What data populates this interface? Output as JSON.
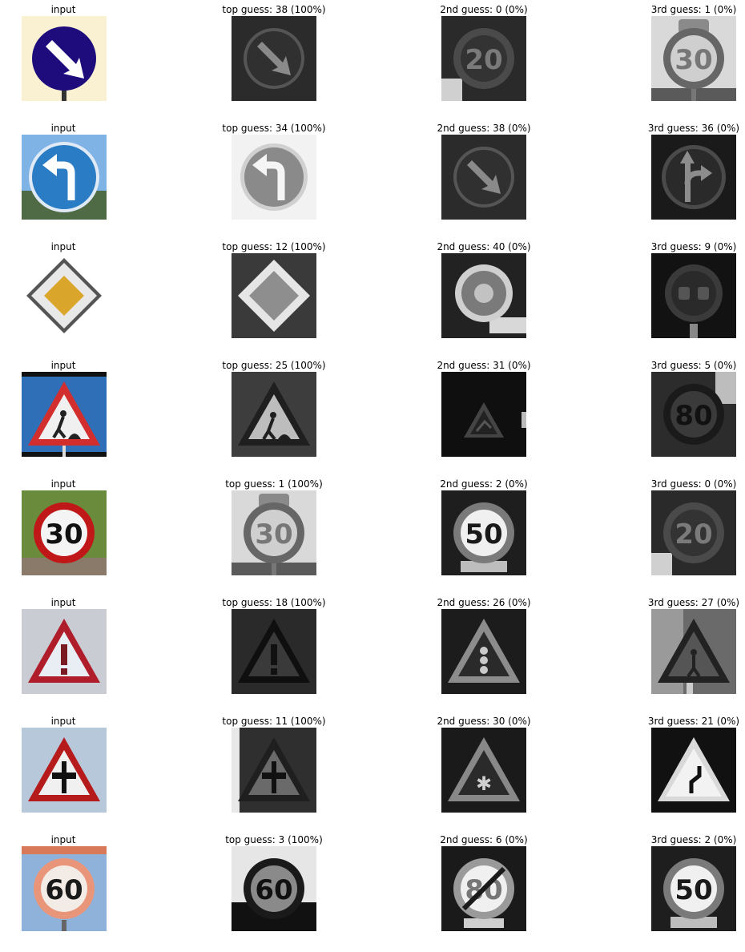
{
  "rows": [
    {
      "cells": [
        {
          "title": "input",
          "image": "input-keep-right-sign",
          "tone": "color"
        },
        {
          "title": "top guess: 38 (100%)",
          "image": "keep-right-sign",
          "tone": "gray"
        },
        {
          "title": "2nd guess: 0 (0%)",
          "image": "speed-limit-20-sign",
          "tone": "gray"
        },
        {
          "title": "3rd guess: 1 (0%)",
          "image": "speed-limit-30-sign",
          "tone": "gray"
        }
      ]
    },
    {
      "cells": [
        {
          "title": "input",
          "image": "input-turn-left-ahead-sign",
          "tone": "color"
        },
        {
          "title": "top guess: 34 (100%)",
          "image": "turn-left-ahead-sign",
          "tone": "gray"
        },
        {
          "title": "2nd guess: 38 (0%)",
          "image": "keep-right-sign",
          "tone": "gray"
        },
        {
          "title": "3rd guess: 36 (0%)",
          "image": "go-straight-or-right-sign",
          "tone": "gray"
        }
      ]
    },
    {
      "cells": [
        {
          "title": "input",
          "image": "input-priority-road-sign",
          "tone": "color"
        },
        {
          "title": "top guess: 12 (100%)",
          "image": "priority-road-sign",
          "tone": "gray"
        },
        {
          "title": "2nd guess: 40 (0%)",
          "image": "roundabout-sign",
          "tone": "gray"
        },
        {
          "title": "3rd guess: 9 (0%)",
          "image": "no-passing-sign",
          "tone": "gray"
        }
      ]
    },
    {
      "cells": [
        {
          "title": "input",
          "image": "input-road-work-sign",
          "tone": "color"
        },
        {
          "title": "top guess: 25 (100%)",
          "image": "road-work-sign",
          "tone": "gray"
        },
        {
          "title": "2nd guess: 31 (0%)",
          "image": "wild-animals-crossing-sign",
          "tone": "gray"
        },
        {
          "title": "3rd guess: 5 (0%)",
          "image": "speed-limit-80-sign",
          "tone": "gray"
        }
      ]
    },
    {
      "cells": [
        {
          "title": "input",
          "image": "input-speed-limit-30-sign",
          "tone": "color"
        },
        {
          "title": "top guess: 1 (100%)",
          "image": "speed-limit-30-sign",
          "tone": "gray"
        },
        {
          "title": "2nd guess: 2 (0%)",
          "image": "speed-limit-50-sign",
          "tone": "gray"
        },
        {
          "title": "3rd guess: 0 (0%)",
          "image": "speed-limit-20-sign",
          "tone": "gray"
        }
      ]
    },
    {
      "cells": [
        {
          "title": "input",
          "image": "input-general-caution-sign",
          "tone": "color"
        },
        {
          "title": "top guess: 18 (100%)",
          "image": "general-caution-sign",
          "tone": "gray"
        },
        {
          "title": "2nd guess: 26 (0%)",
          "image": "traffic-signals-sign",
          "tone": "gray"
        },
        {
          "title": "3rd guess: 27 (0%)",
          "image": "pedestrians-sign",
          "tone": "gray"
        }
      ]
    },
    {
      "cells": [
        {
          "title": "input",
          "image": "input-right-of-way-sign",
          "tone": "color"
        },
        {
          "title": "top guess: 11 (100%)",
          "image": "right-of-way-sign",
          "tone": "gray"
        },
        {
          "title": "2nd guess: 30 (0%)",
          "image": "ice-snow-sign",
          "tone": "gray"
        },
        {
          "title": "3rd guess: 21 (0%)",
          "image": "double-curve-sign",
          "tone": "gray"
        }
      ]
    },
    {
      "cells": [
        {
          "title": "input",
          "image": "input-speed-limit-60-sign",
          "tone": "color"
        },
        {
          "title": "top guess: 3 (100%)",
          "image": "speed-limit-60-sign",
          "tone": "gray"
        },
        {
          "title": "2nd guess: 6 (0%)",
          "image": "end-of-speed-limit-80-sign",
          "tone": "gray"
        },
        {
          "title": "3rd guess: 2 (0%)",
          "image": "speed-limit-50-sign",
          "tone": "gray"
        }
      ]
    }
  ]
}
